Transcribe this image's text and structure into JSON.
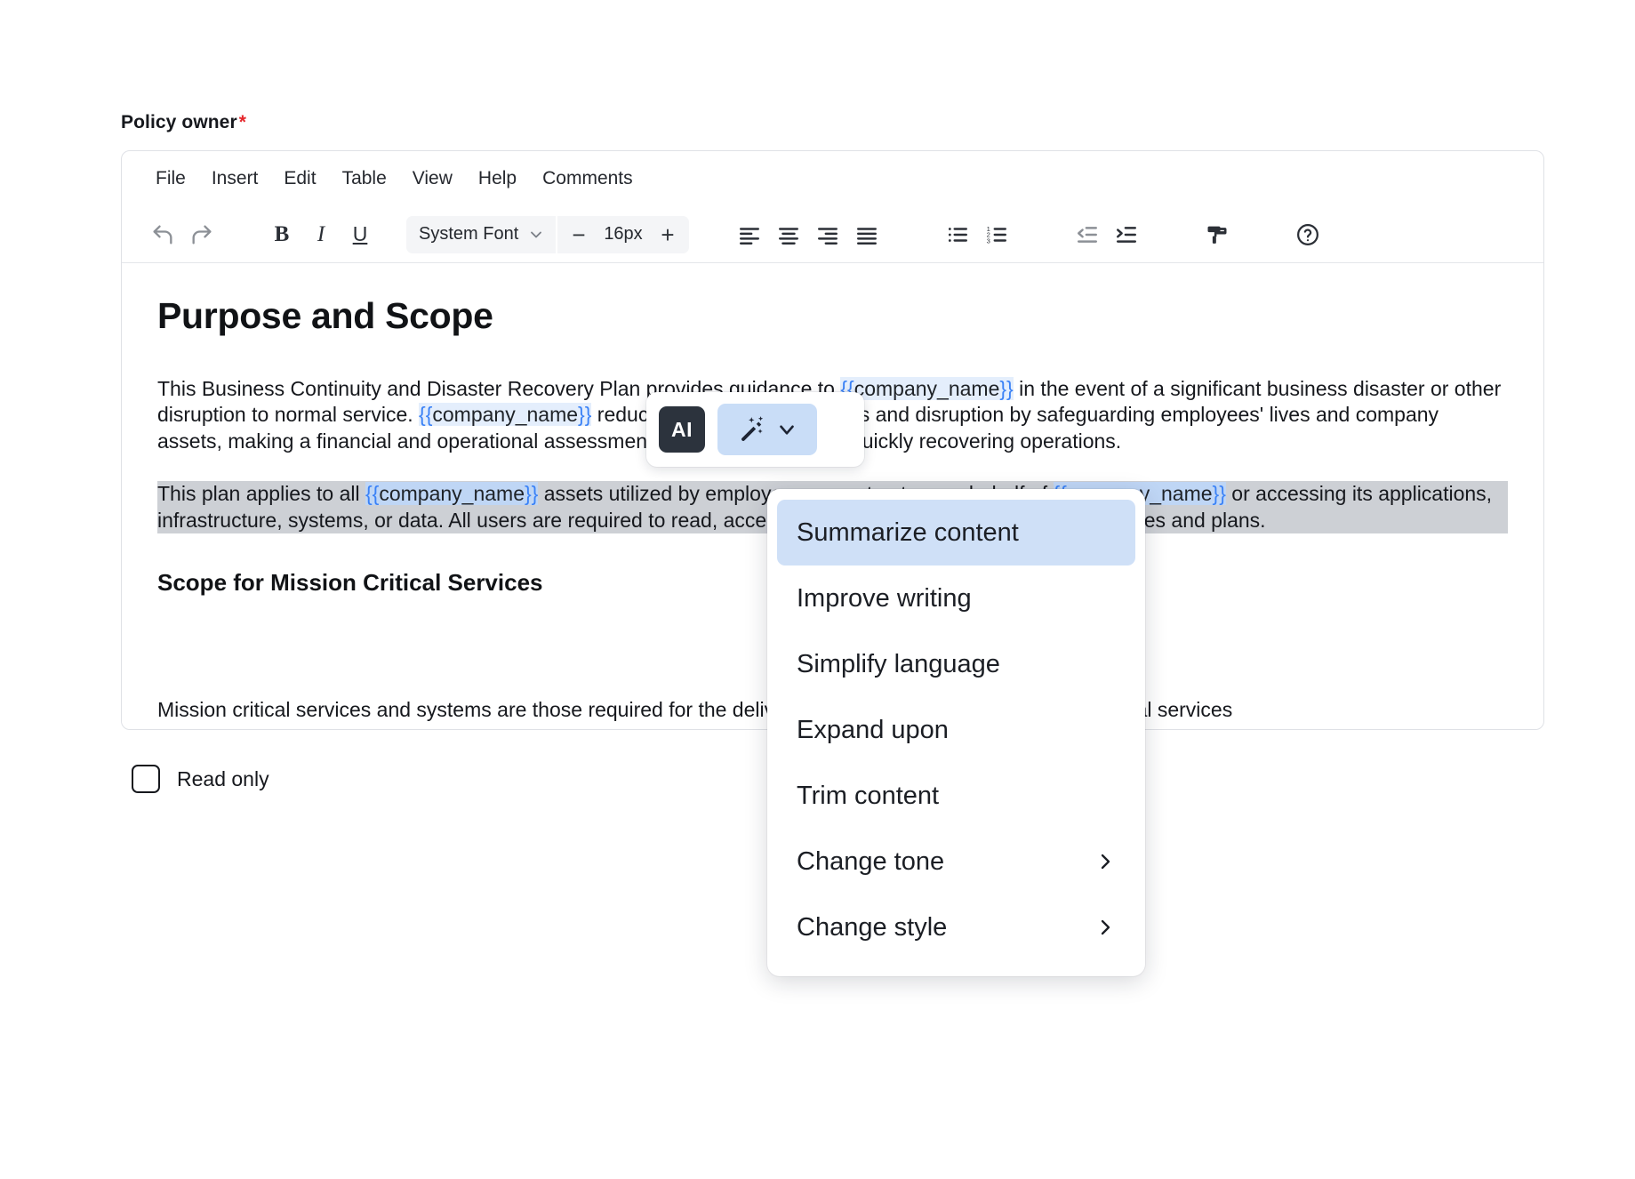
{
  "field": {
    "label": "Policy owner",
    "required_marker": "*"
  },
  "editor": {
    "menubar": [
      {
        "label": "File",
        "name": "menu-file"
      },
      {
        "label": "Insert",
        "name": "menu-insert"
      },
      {
        "label": "Edit",
        "name": "menu-edit"
      },
      {
        "label": "Table",
        "name": "menu-table"
      },
      {
        "label": "View",
        "name": "menu-view"
      },
      {
        "label": "Help",
        "name": "menu-help"
      },
      {
        "label": "Comments",
        "name": "menu-comments"
      }
    ],
    "toolbar": {
      "undo_icon": "undo-icon",
      "redo_icon": "redo-icon",
      "bold_label": "B",
      "italic_label": "I",
      "underline_label": "U",
      "font_family_value": "System Font",
      "font_family_caret": "chevron-down-icon",
      "font_size_decrease": "−",
      "font_size_value": "16px",
      "font_size_increase": "+",
      "align_left_icon": "align-left-icon",
      "align_center_icon": "align-center-icon",
      "align_right_icon": "align-right-icon",
      "align_justify_icon": "align-justify-icon",
      "bullet_list_icon": "bullet-list-icon",
      "numbered_list_icon": "numbered-list-icon",
      "outdent_icon": "outdent-icon",
      "indent_icon": "indent-icon",
      "format_painter_icon": "format-painter-icon",
      "help_icon": "help-circle-icon"
    },
    "document": {
      "heading": "Purpose and Scope",
      "paragraph1": {
        "part1": "This Business Continuity and Disaster Recovery Plan provides guidance to ",
        "placeholder1": "{{company_name}}",
        "part2": " in the event of a significant business disaster or other disruption to normal service. ",
        "placeholder2": "{{company_name}}",
        "part3": " reduces the effect of disasters and disruption by safeguarding employees' lives and company assets, making a financial and operational assessment, protecting data, and quickly recovering operations."
      },
      "paragraph2": {
        "part1": "This plan applies to all ",
        "placeholder1": "{{company_name}}",
        "part2": " assets utilized by employees or contractors on behalf of ",
        "placeholder2": "{{company_name}}",
        "part3": " or accessing its applications, infrastructure, systems, or data. All users are required to read, accept, and follow all ",
        "placeholder3": "{{company_name}}",
        "part4": " policies and plans.",
        "selected": true
      },
      "subheading": "Scope for Mission Critical Services",
      "clipped_paragraph": "Mission critical services and systems are those required for the delivery of the core product(s). Mission Critical services"
    }
  },
  "read_only": {
    "label": "Read only",
    "checked": false
  },
  "ai_toolbar": {
    "badge_label": "AI",
    "wand_icon": "magic-wand-icon",
    "caret_icon": "chevron-down-icon"
  },
  "ai_menu": {
    "items": [
      {
        "label": "Summarize content",
        "name": "ai-menu-summarize-content",
        "active": true,
        "submenu": false
      },
      {
        "label": "Improve writing",
        "name": "ai-menu-improve-writing",
        "active": false,
        "submenu": false
      },
      {
        "label": "Simplify language",
        "name": "ai-menu-simplify-language",
        "active": false,
        "submenu": false
      },
      {
        "label": "Expand upon",
        "name": "ai-menu-expand-upon",
        "active": false,
        "submenu": false
      },
      {
        "label": "Trim content",
        "name": "ai-menu-trim-content",
        "active": false,
        "submenu": false
      },
      {
        "label": "Change tone",
        "name": "ai-menu-change-tone",
        "active": false,
        "submenu": true
      },
      {
        "label": "Change style",
        "name": "ai-menu-change-style",
        "active": false,
        "submenu": true
      }
    ]
  },
  "colors": {
    "placeholder_brace": "#3b82f6",
    "placeholder_bg": "#e4eefc",
    "selection_bg": "#cdd0d5",
    "ai_active_bg": "#cfe0f7",
    "ai_badge_bg": "#2c333d",
    "required_star": "#e5252a"
  }
}
